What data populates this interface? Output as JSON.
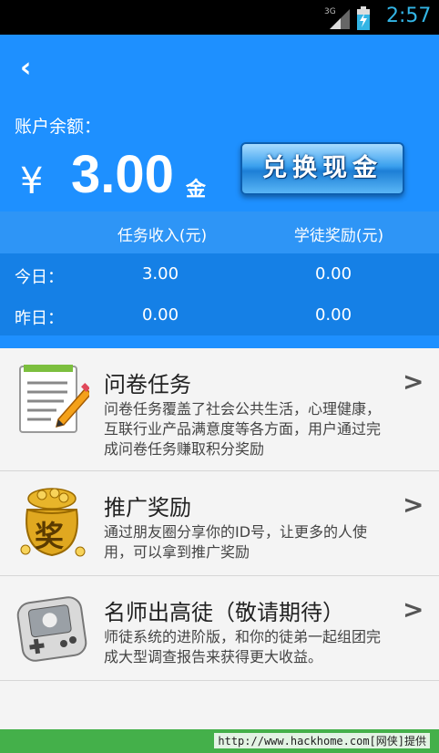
{
  "statusbar": {
    "network": "3G",
    "time": "2:57"
  },
  "header": {
    "back_icon": "‹",
    "balance_label": "账户余额：",
    "currency": "¥",
    "amount": "3.00",
    "unit": "金",
    "cash_button": "兑换现金"
  },
  "stats": {
    "col_task": "任务收入(元)",
    "col_apprentice": "学徒奖励(元)",
    "rows": [
      {
        "label": "今日：",
        "task": "3.00",
        "apprentice": "0.00"
      },
      {
        "label": "昨日：",
        "task": "0.00",
        "apprentice": "0.00"
      }
    ]
  },
  "items": [
    {
      "title": "问卷任务",
      "desc": "问卷任务覆盖了社会公共生活，心理健康，互联行业产品满意度等各方面，用户通过完成问卷任务赚取积分奖励",
      "icon": "survey-document-icon",
      "arrow": ">"
    },
    {
      "title": "推广奖励",
      "desc": "通过朋友圈分享你的ID号，让更多的人使用，可以拿到推广奖励",
      "icon": "gold-reward-bag-icon",
      "icon_char": "奖",
      "arrow": ">"
    },
    {
      "title": "名师出高徒（敬请期待）",
      "desc": "师徒系统的进阶版，和你的徒弟一起组团完成大型调查报告来获得更大收益。",
      "icon": "game-console-icon",
      "arrow": ">"
    }
  ],
  "watermark": "http://www.hackhome.com[网侠]提供",
  "colors": {
    "primary": "#1e90ff",
    "stats_head": "#2e95f6",
    "stats_body": "#1580e6",
    "footer": "#44b04a"
  }
}
